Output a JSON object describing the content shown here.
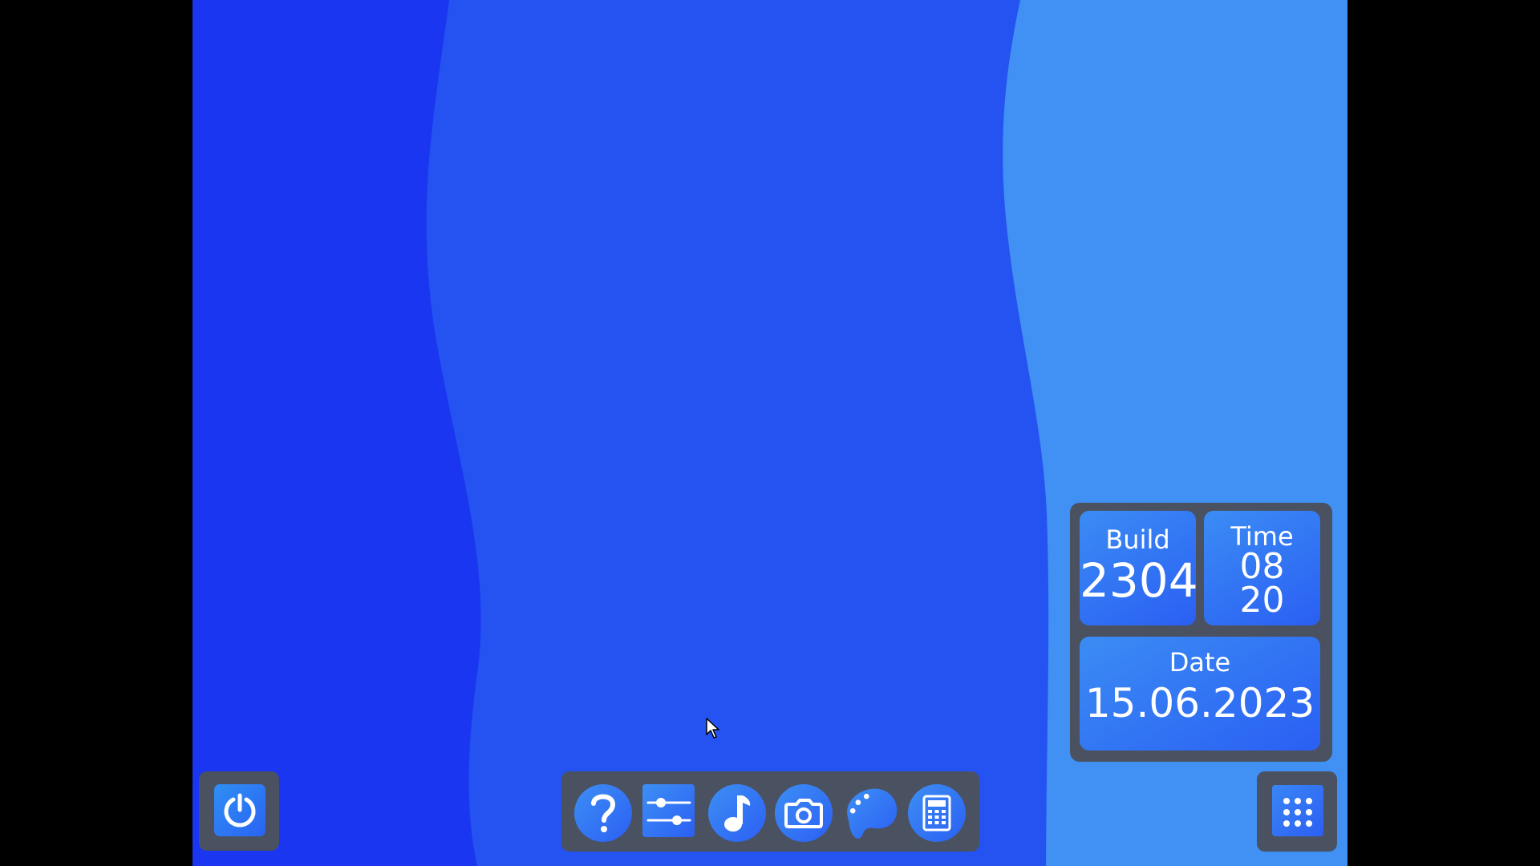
{
  "colors": {
    "wallpaper_left": "#1a36f0",
    "wallpaper_mid": "#2453f2",
    "wallpaper_right": "#4190f4",
    "panel": "#4a5161",
    "tile_light": "#3b8cf4",
    "tile_dark": "#2a5ff3",
    "text": "#ffffff"
  },
  "power_button": {
    "icon": "power-icon"
  },
  "dock": {
    "items": [
      {
        "icon": "help-icon",
        "shape": "round"
      },
      {
        "icon": "sliders-icon",
        "shape": "square"
      },
      {
        "icon": "music-note-icon",
        "shape": "round"
      },
      {
        "icon": "camera-icon",
        "shape": "round"
      },
      {
        "icon": "paint-palette-icon",
        "shape": "round"
      },
      {
        "icon": "calculator-icon",
        "shape": "round"
      }
    ]
  },
  "info_widget": {
    "build": {
      "label": "Build",
      "value": "2304"
    },
    "time": {
      "label": "Time",
      "hours": "08",
      "minutes": "20"
    },
    "date": {
      "label": "Date",
      "value": "15.06.2023"
    }
  },
  "apps_button": {
    "icon": "app-grid-icon"
  },
  "cursor": {
    "icon": "mouse-pointer-icon"
  }
}
